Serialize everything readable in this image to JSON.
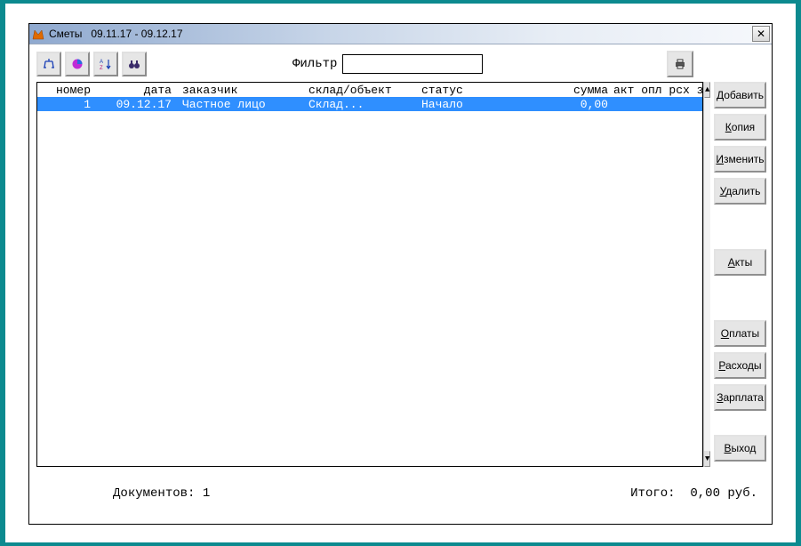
{
  "window": {
    "title": "Сметы   09.11.17 - 09.12.17"
  },
  "toolbar": {
    "filter_label": "Фильтр",
    "filter_value": ""
  },
  "grid": {
    "headers": {
      "num": "номер",
      "date": "дата",
      "customer": "заказчик",
      "warehouse": "склад/объект",
      "status": "статус",
      "sum": "сумма",
      "flags": "акт опл рсх з/п"
    },
    "rows": [
      {
        "num": "1",
        "date": "09.12.17",
        "customer": "Частное лицо",
        "warehouse": "Склад...",
        "status": "Начало",
        "sum": "0,00",
        "flags": ""
      }
    ]
  },
  "buttons": {
    "add": "Добавить",
    "copy": "Копия",
    "edit": "Изменить",
    "delete": "Удалить",
    "acts": "Акты",
    "payments": "Оплаты",
    "expenses": "Расходы",
    "salary": "Зарплата",
    "exit": "Выход"
  },
  "status": {
    "docs_label": "Документов:",
    "docs_count": "1",
    "total_label": "Итого:",
    "total_value": "0,00",
    "currency": "руб."
  }
}
